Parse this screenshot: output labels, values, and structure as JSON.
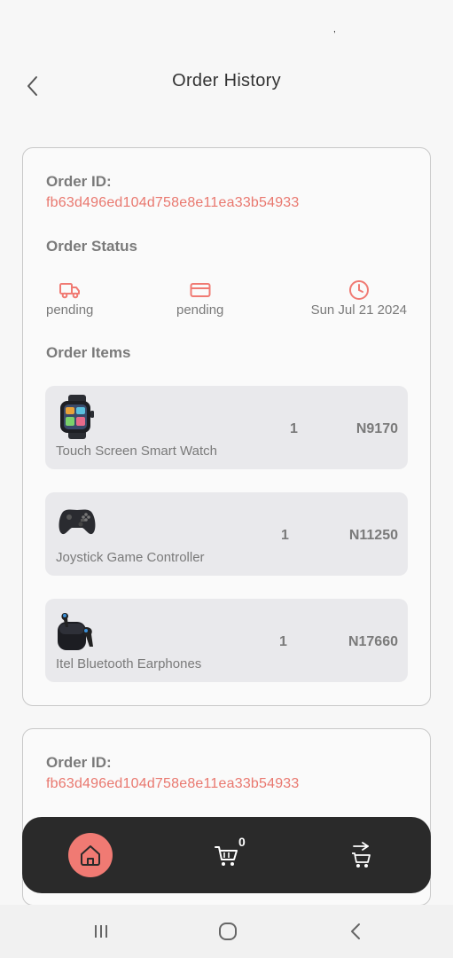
{
  "status_bar": {
    "glyph": ","
  },
  "header": {
    "title": "Order History"
  },
  "orders": [
    {
      "order_id_label": "Order ID:",
      "order_id": "fb63d496ed104d758e8e11ea33b54933",
      "status_label": "Order Status",
      "status": {
        "delivery": "pending",
        "payment": "pending",
        "date": "Sun Jul 21 2024"
      },
      "items_label": "Order Items",
      "items": [
        {
          "name": "Touch Screen Smart Watch",
          "qty": "1",
          "price": "N9170",
          "thumb": "smart-watch"
        },
        {
          "name": "Joystick Game Controller",
          "qty": "1",
          "price": "N11250",
          "thumb": "game-controller"
        },
        {
          "name": "Itel Bluetooth Earphones",
          "qty": "1",
          "price": "N17660",
          "thumb": "earphones"
        }
      ]
    },
    {
      "order_id_label": "Order ID:",
      "order_id": "fb63d496ed104d758e8e11ea33b54933"
    }
  ],
  "bottom_nav": {
    "items": [
      "home-icon",
      "cart-icon",
      "orders-icon"
    ],
    "cart_count": "0"
  },
  "colors": {
    "accent": "#f07a73",
    "order_id": "#e9786f",
    "nav_bg": "#2a2a2a",
    "item_bg": "#e9e9ec"
  }
}
